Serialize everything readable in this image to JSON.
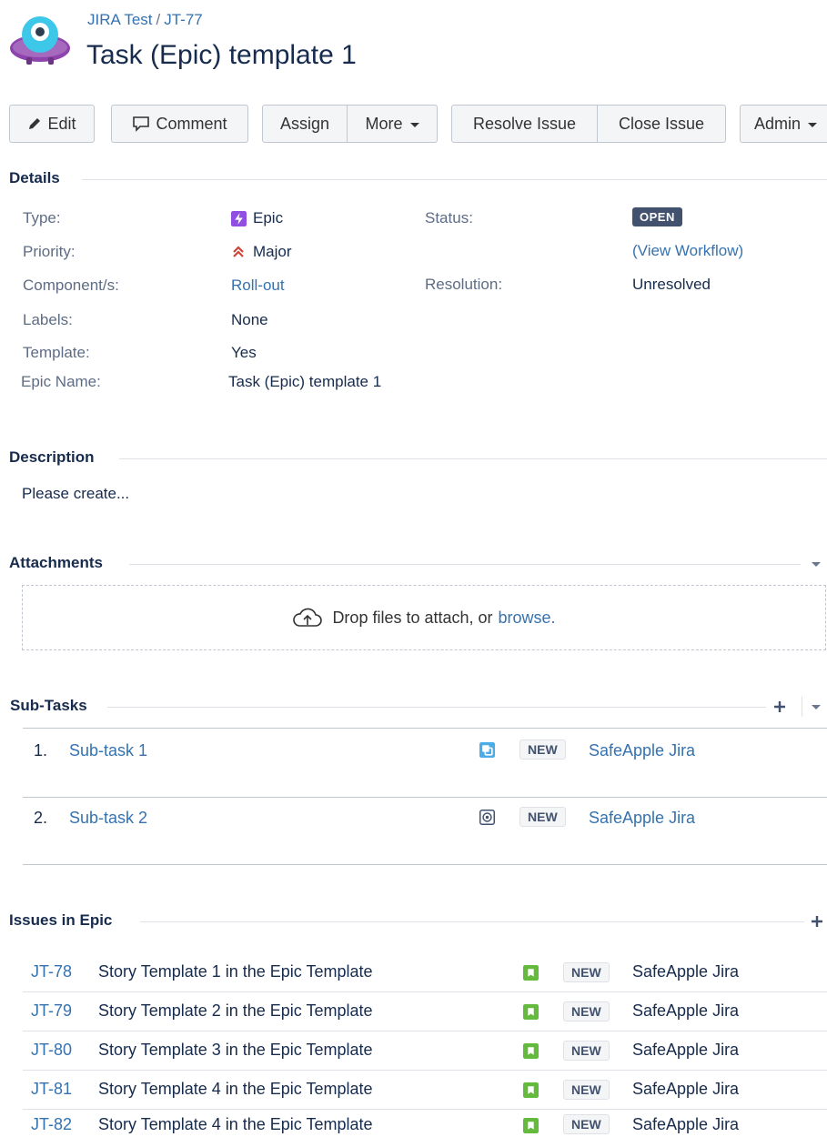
{
  "breadcrumb": {
    "project": "JIRA Test",
    "separator": "/",
    "issue_key": "JT-77"
  },
  "page_title": "Task (Epic) template 1",
  "toolbar": {
    "edit": "Edit",
    "comment": "Comment",
    "assign": "Assign",
    "more": "More",
    "resolve": "Resolve Issue",
    "close": "Close Issue",
    "admin": "Admin"
  },
  "details": {
    "heading": "Details",
    "type_label": "Type:",
    "type_value": "Epic",
    "priority_label": "Priority:",
    "priority_value": "Major",
    "component_label": "Component/s:",
    "component_value": "Roll-out",
    "labels_label": "Labels:",
    "labels_value": "None",
    "template_label": "Template:",
    "template_value": "Yes",
    "epic_name_label": "Epic Name:",
    "epic_name_value": "Task (Epic) template 1",
    "status_label": "Status:",
    "status_value": "OPEN",
    "view_workflow": "(View Workflow)",
    "resolution_label": "Resolution:",
    "resolution_value": "Unresolved"
  },
  "description": {
    "heading": "Description",
    "text": "Please create..."
  },
  "attachments": {
    "heading": "Attachments",
    "drop_text": "Drop files to attach, or",
    "browse": "browse."
  },
  "subtasks": {
    "heading": "Sub-Tasks",
    "items": [
      {
        "num": "1.",
        "title": "Sub-task 1",
        "status": "NEW",
        "assignee": "SafeApple Jira",
        "icon": "subtask-icon"
      },
      {
        "num": "2.",
        "title": "Sub-task 2",
        "status": "NEW",
        "assignee": "SafeApple Jira",
        "icon": "target-icon"
      }
    ]
  },
  "epic_issues": {
    "heading": "Issues in Epic",
    "items": [
      {
        "key": "JT-78",
        "summary": "Story Template 1 in the Epic Template",
        "status": "NEW",
        "assignee": "SafeApple Jira"
      },
      {
        "key": "JT-79",
        "summary": "Story Template 2 in the Epic Template",
        "status": "NEW",
        "assignee": "SafeApple Jira"
      },
      {
        "key": "JT-80",
        "summary": "Story Template 3 in the Epic Template",
        "status": "NEW",
        "assignee": "SafeApple Jira"
      },
      {
        "key": "JT-81",
        "summary": "Story Template 4 in the Epic Template",
        "status": "NEW",
        "assignee": "SafeApple Jira"
      },
      {
        "key": "JT-82",
        "summary": "Story Template 4 in the Epic Template",
        "status": "NEW",
        "assignee": "SafeApple Jira"
      }
    ]
  },
  "colors": {
    "link": "#3572b0",
    "epic": "#904ee2",
    "story": "#63ba3c",
    "subtask": "#4bade8",
    "priority": "#d04437",
    "status_badge": "#42526e"
  }
}
